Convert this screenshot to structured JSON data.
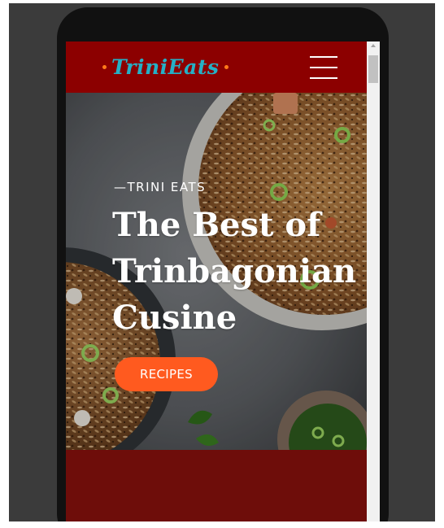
{
  "brand": {
    "logo_text": "TriniEats",
    "logo_color": "#25b0c6",
    "nav_color": "#8c0000"
  },
  "nav": {
    "menu_icon": "hamburger-menu-icon"
  },
  "hero": {
    "eyebrow": "—TRINI EATS",
    "title": "The Best of Trinbagonian Cusine",
    "cta_label": "RECIPES",
    "cta_color": "#ff5a1f"
  },
  "section_below": {
    "background": "#6e0d0a"
  }
}
